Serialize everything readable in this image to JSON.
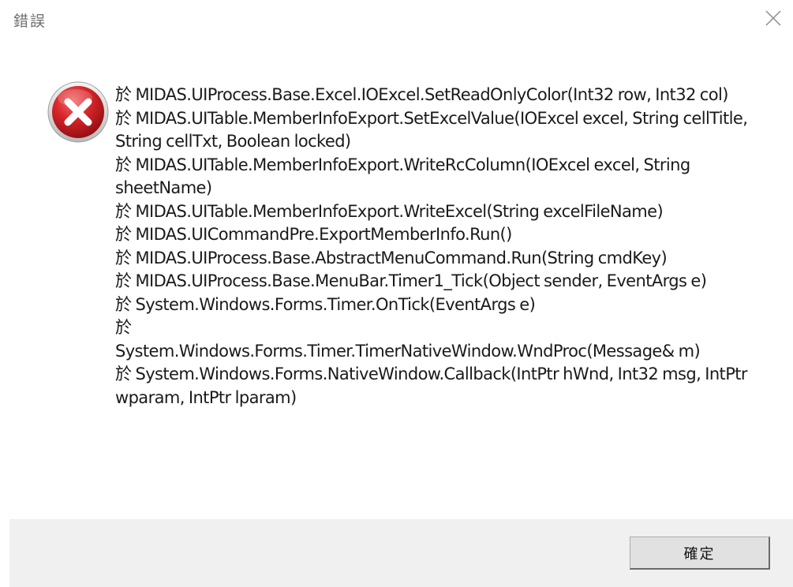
{
  "dialog": {
    "title": "錯誤",
    "icon": "error-icon",
    "message": "  於 MIDAS.UIProcess.Base.Excel.IOExcel.SetReadOnlyColor(Int32 row, Int32 col)\n  於 MIDAS.UITable.MemberInfoExport.SetExcelValue(IOExcel excel, String cellTitle, String cellTxt, Boolean locked)\n  於 MIDAS.UITable.MemberInfoExport.WriteRcColumn(IOExcel excel, String sheetName)\n  於 MIDAS.UITable.MemberInfoExport.WriteExcel(String excelFileName)\n  於 MIDAS.UICommandPre.ExportMemberInfo.Run()\n  於 MIDAS.UIProcess.Base.AbstractMenuCommand.Run(String cmdKey)\n  於 MIDAS.UIProcess.Base.MenuBar.Timer1_Tick(Object sender, EventArgs e)\n  於 System.Windows.Forms.Timer.OnTick(EventArgs e)\n  於\nSystem.Windows.Forms.Timer.TimerNativeWindow.WndProc(Message& m)\n  於 System.Windows.Forms.NativeWindow.Callback(IntPtr hWnd, Int32 msg, IntPtr wparam, IntPtr lparam)",
    "ok_label": "確定"
  },
  "colors": {
    "error_red": "#c8161d",
    "footer_bg": "#f0f0f0",
    "button_bg": "#e1e1e1"
  }
}
